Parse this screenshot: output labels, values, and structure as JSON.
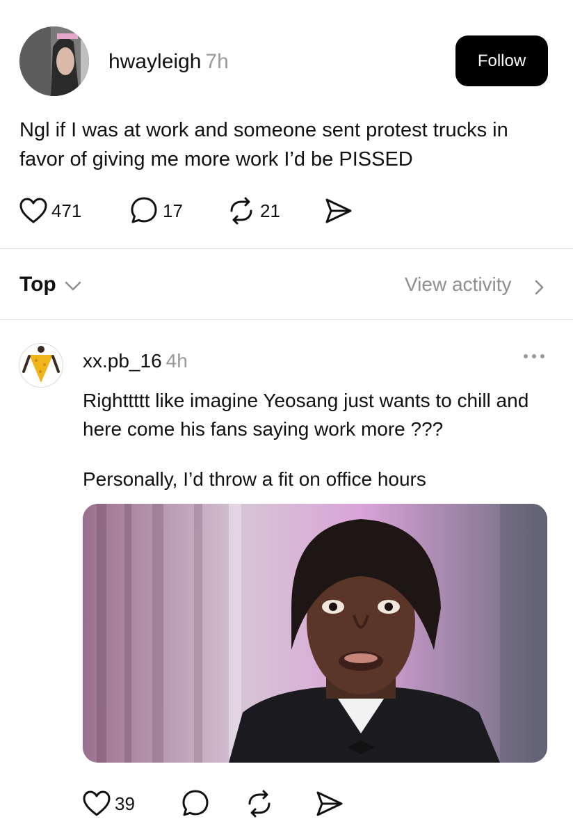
{
  "post": {
    "username": "hwayleigh",
    "time": "7h",
    "follow_label": "Follow",
    "text": "Ngl if I was at work and someone sent protest trucks in favor of giving me more work I’d be PISSED",
    "likes": "471",
    "comments": "17",
    "reposts": "21"
  },
  "replies_header": {
    "sort_label": "Top",
    "view_activity_label": "View activity"
  },
  "reply": {
    "username": "xx.pb_16",
    "time": "4h",
    "text_line1": "Righttttt like imagine Yeosang just wants to chill and here come his fans saying work more ???",
    "text_line2": "Personally, I’d throw a fit on office hours",
    "likes": "39"
  },
  "icons": {
    "like": "heart-icon",
    "comment": "comment-bubble-icon",
    "repost": "repost-icon",
    "share": "send-icon",
    "more": "more-dots-icon",
    "chevron": "chevron-down-icon",
    "chevron_right": "chevron-right-icon"
  }
}
